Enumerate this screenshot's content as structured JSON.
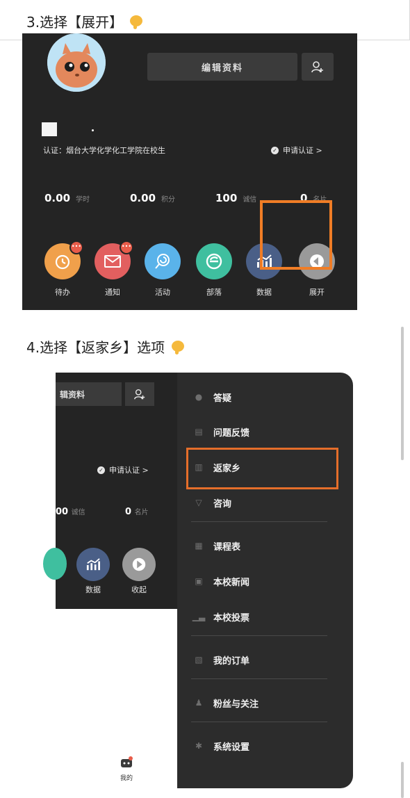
{
  "step3": {
    "title": "3.选择【展开】",
    "edit_profile": "编辑资料",
    "cert_text": "认证：烟台大学化学化工学院在校生",
    "apply_cert": "申请认证 >",
    "stats": [
      {
        "value": "0.00",
        "unit": "学时"
      },
      {
        "value": "0.00",
        "unit": "积分"
      },
      {
        "value": "100",
        "unit": "诚信"
      },
      {
        "value": "0",
        "unit": "名片"
      }
    ],
    "icons": [
      {
        "label": "待办",
        "color": "#f0a04b",
        "badge": "•••"
      },
      {
        "label": "通知",
        "color": "#e25f5f",
        "badge": "•••"
      },
      {
        "label": "活动",
        "color": "#5ab3ea",
        "badge": ""
      },
      {
        "label": "部落",
        "color": "#3fbf9f",
        "badge": ""
      },
      {
        "label": "数据",
        "color": "#4a5f87",
        "badge": ""
      },
      {
        "label": "展开",
        "color": "#9a9a9a",
        "badge": ""
      }
    ]
  },
  "step4": {
    "title": "4.选择【返家乡】选项",
    "edit_profile_partial": "辑资料",
    "apply_cert": "申请认证 >",
    "stat_a": {
      "value": "00",
      "unit": "诚信"
    },
    "stat_b": {
      "value": "0",
      "unit": "名片"
    },
    "icons": [
      {
        "label": "数据",
        "color": "#4a5f87"
      },
      {
        "label": "收起",
        "color": "#9a9a9a"
      }
    ],
    "menu": [
      {
        "label": "答疑",
        "icon": "question-icon"
      },
      {
        "label": "问题反馈",
        "icon": "feedback-icon"
      },
      {
        "label": "返家乡",
        "icon": "chart-icon"
      },
      {
        "label": "咨询",
        "icon": "chat-icon"
      },
      {
        "label": "课程表",
        "icon": "calendar-icon"
      },
      {
        "label": "本校新闻",
        "icon": "news-icon"
      },
      {
        "label": "本校投票",
        "icon": "vote-icon"
      },
      {
        "label": "我的订单",
        "icon": "order-icon"
      },
      {
        "label": "粉丝与关注",
        "icon": "fans-icon"
      },
      {
        "label": "系统设置",
        "icon": "settings-icon"
      }
    ],
    "bottom_tab": "我的"
  },
  "colors": {
    "highlight": "#f07d26",
    "panel": "#242424",
    "menu_bg": "#2c2c2c"
  }
}
